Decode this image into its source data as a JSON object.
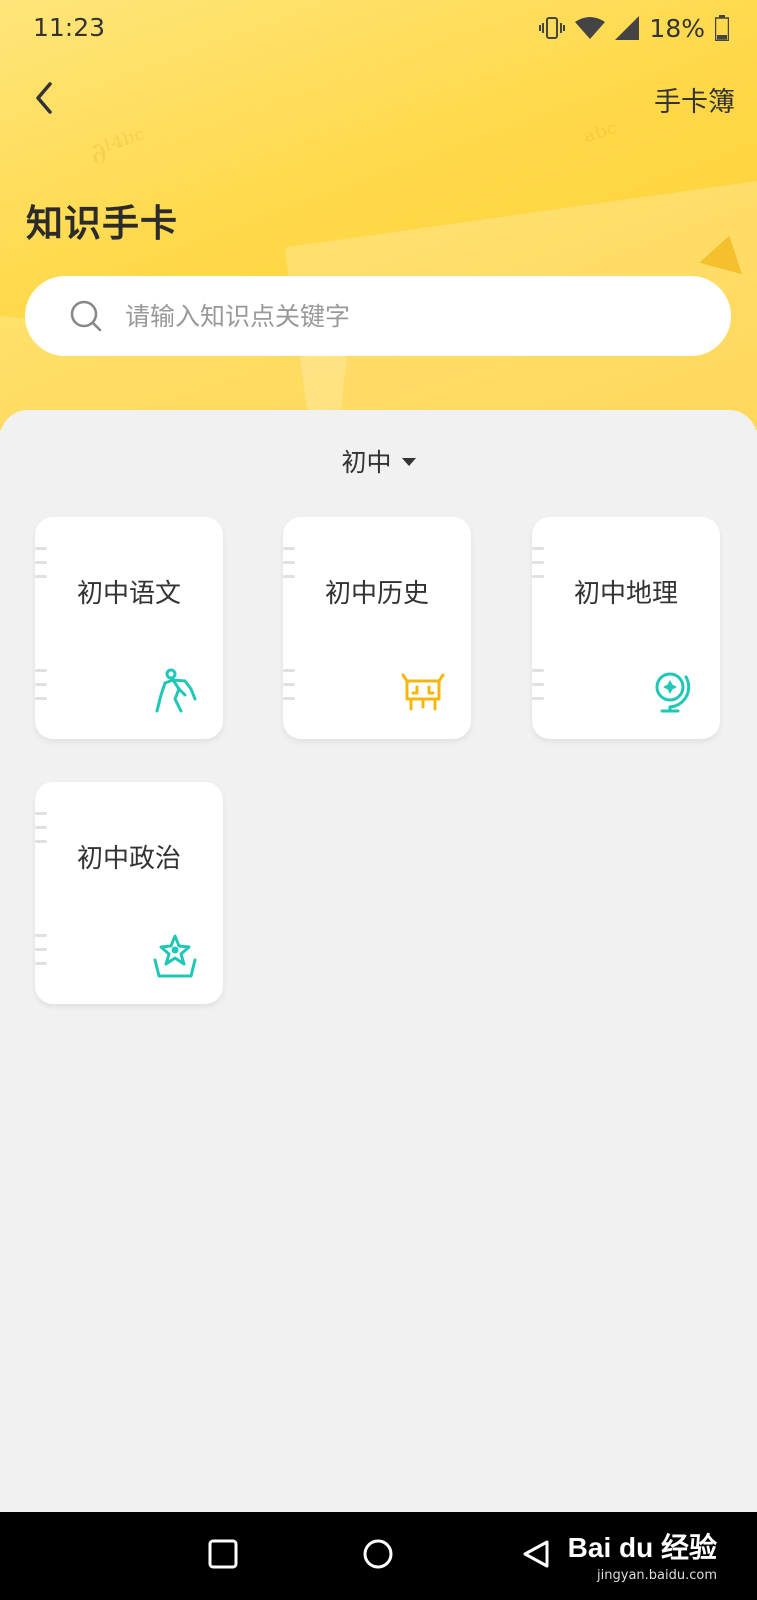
{
  "status_bar": {
    "time": "11:23",
    "battery_percent": "18%",
    "icons": [
      "vibrate-icon",
      "wifi-icon",
      "signal-icon",
      "battery-icon"
    ]
  },
  "header": {
    "back_icon": "chevron-left-icon",
    "right_link": "手卡簿",
    "title": "知识手卡"
  },
  "search": {
    "placeholder": "请输入知识点关键字",
    "icon": "search-icon"
  },
  "grade_selector": {
    "label": "初中"
  },
  "cards": [
    {
      "label": "初中语文",
      "icon": "hiker-icon",
      "icon_color": "#1fc7b6"
    },
    {
      "label": "初中历史",
      "icon": "ancient-vessel-icon",
      "icon_color": "#f5b70f"
    },
    {
      "label": "初中地理",
      "icon": "globe-icon",
      "icon_color": "#1fc7b6"
    },
    {
      "label": "初中政治",
      "icon": "star-badge-icon",
      "icon_color": "#1fc7b6"
    }
  ],
  "nav_bar": {
    "buttons": [
      "recent-apps-icon",
      "home-icon",
      "back-triangle-icon"
    ]
  },
  "watermark": {
    "brand": "Bai du 经验",
    "url": "jingyan.baidu.com"
  },
  "colors": {
    "header_gradient_start": "#ffe57a",
    "header_gradient_end": "#ffcc2e",
    "background": "#f1f1f1",
    "accent_teal": "#1fc7b6",
    "accent_yellow": "#f5b70f"
  }
}
